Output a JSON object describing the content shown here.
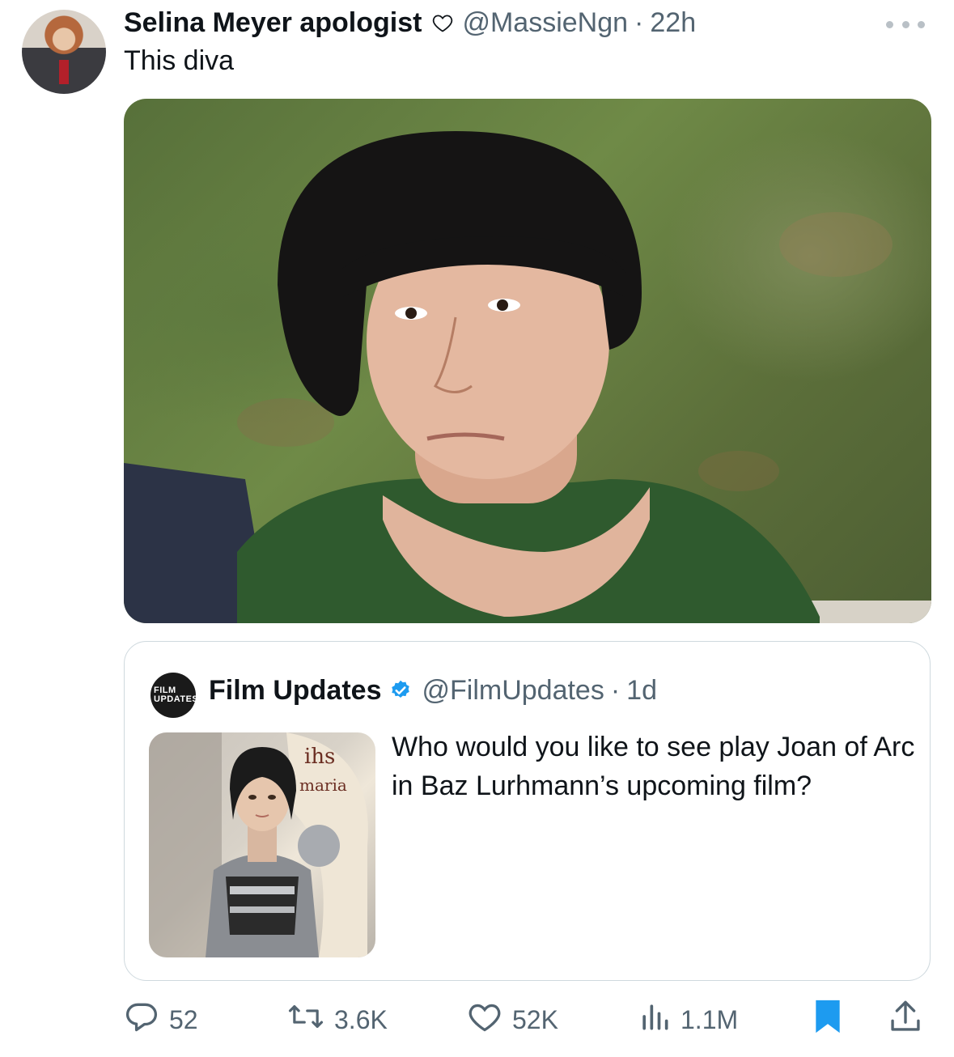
{
  "tweet": {
    "display_name": "Selina Meyer apologist",
    "handle": "@MassieNgn",
    "separator": "·",
    "time": "22h",
    "text": "This diva",
    "more_icon": "more-horizontal-icon",
    "name_decoration_icon": "heart-outline-icon"
  },
  "quoted_tweet": {
    "avatar_text_line1": "FILM",
    "avatar_text_line2": "UPDATES",
    "display_name": "Film Updates",
    "handle": "@FilmUpdates",
    "separator": "·",
    "time": "1d",
    "text": "Who would you like to see play Joan of Arc in Baz Lurhmann’s upcoming film?",
    "verified_icon": "verified-badge-icon",
    "verified_color": "#1d9bf0",
    "painting_text_1": "ihs",
    "painting_text_2": "maria"
  },
  "actions": {
    "replies": "52",
    "reposts": "3.6K",
    "likes": "52K",
    "views": "1.1M",
    "bookmark_color": "#1d9bf0"
  }
}
